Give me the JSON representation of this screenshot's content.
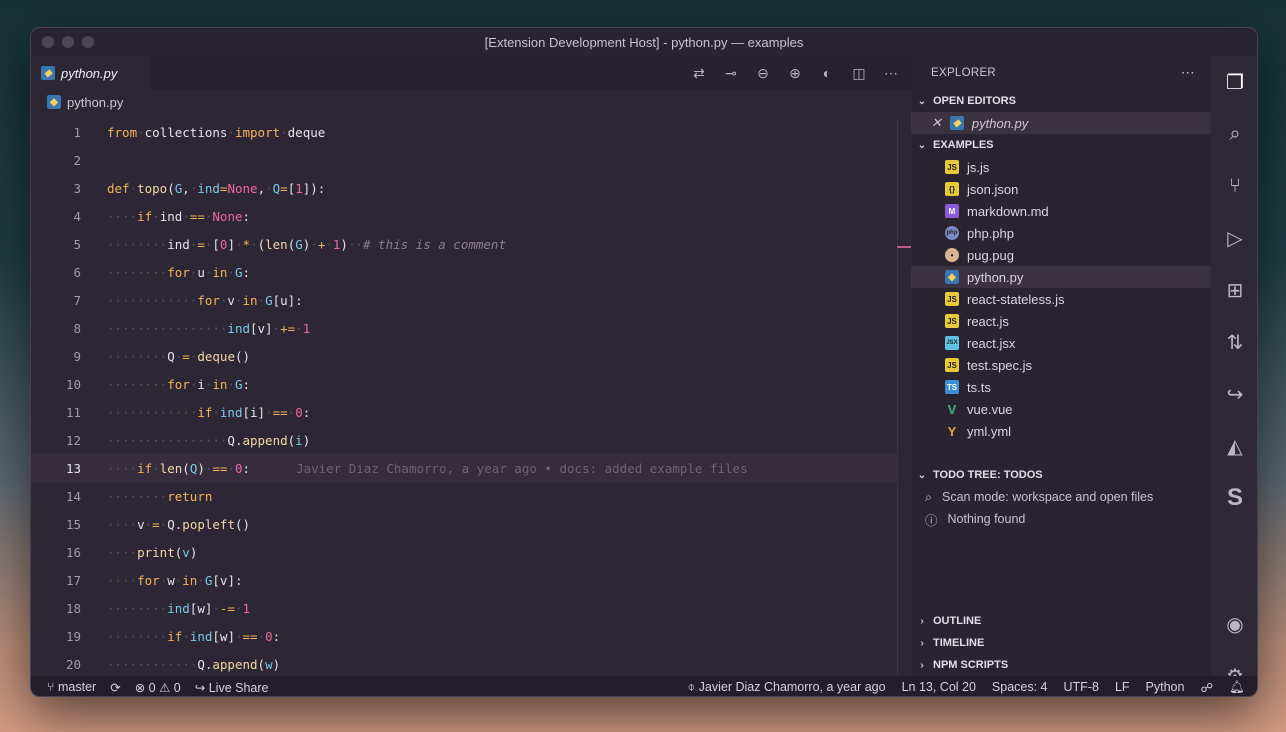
{
  "window": {
    "title": "[Extension Development Host] - python.py — examples"
  },
  "editor": {
    "tab_label": "python.py",
    "breadcrumb": "python.py",
    "blame": "Javier Diaz Chamorro, a year ago • docs: added example files",
    "comment": "# this is a comment",
    "line_numbers": [
      "1",
      "2",
      "3",
      "4",
      "5",
      "6",
      "7",
      "8",
      "9",
      "10",
      "11",
      "12",
      "13",
      "14",
      "15",
      "16",
      "17",
      "18",
      "19",
      "20"
    ]
  },
  "sidebar": {
    "title": "EXPLORER",
    "open_editors_label": "OPEN EDITORS",
    "open_editor_file": "python.py",
    "examples_label": "EXAMPLES",
    "files": [
      {
        "name": "js.js",
        "icon": "js-icon"
      },
      {
        "name": "json.json",
        "icon": "json-icon"
      },
      {
        "name": "markdown.md",
        "icon": "markdown-icon"
      },
      {
        "name": "php.php",
        "icon": "php-icon"
      },
      {
        "name": "pug.pug",
        "icon": "pug-icon"
      },
      {
        "name": "python.py",
        "icon": "python-icon"
      },
      {
        "name": "react-stateless.js",
        "icon": "js-icon"
      },
      {
        "name": "react.js",
        "icon": "js-icon"
      },
      {
        "name": "react.jsx",
        "icon": "jsx-icon"
      },
      {
        "name": "test.spec.js",
        "icon": "js-icon"
      },
      {
        "name": "ts.ts",
        "icon": "ts-icon"
      },
      {
        "name": "vue.vue",
        "icon": "vue-icon"
      },
      {
        "name": "yml.yml",
        "icon": "yaml-icon"
      }
    ],
    "todo_label": "TODO TREE: TODOS",
    "todo_scan": "Scan mode: workspace and open files",
    "todo_none": "Nothing found",
    "outline_label": "OUTLINE",
    "timeline_label": "TIMELINE",
    "npm_label": "NPM SCRIPTS"
  },
  "status": {
    "branch": "master",
    "errors": "0",
    "warnings": "0",
    "live_share": "Live Share",
    "blame": "Javier Diaz Chamorro, a year ago",
    "position": "Ln 13, Col 20",
    "spaces": "Spaces: 4",
    "encoding": "UTF-8",
    "eol": "LF",
    "language": "Python"
  }
}
